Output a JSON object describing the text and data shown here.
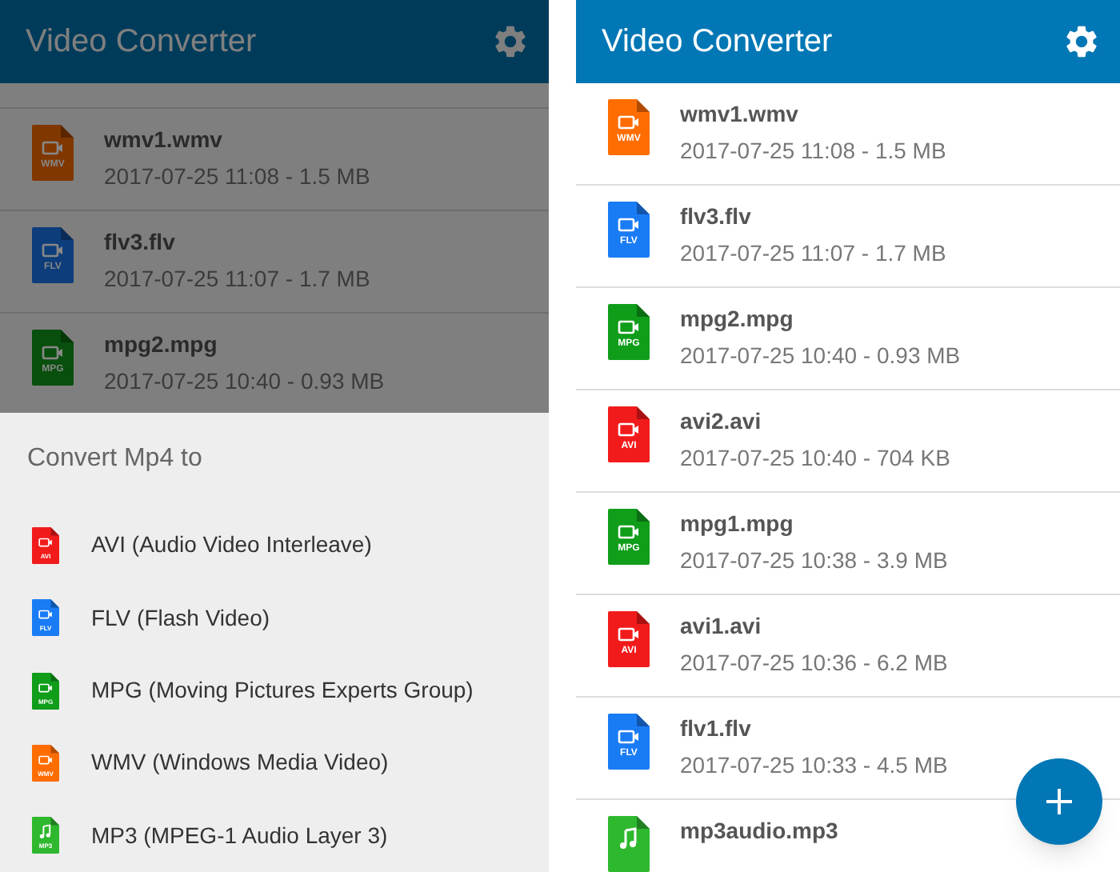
{
  "left_screen": {
    "app_bar": {
      "title": "Video Converter"
    },
    "dimmed": true,
    "files": [
      {
        "name": "wmv1.wmv",
        "meta": "2017-07-25 11:08 - 1.5 MB",
        "kind": "video",
        "format": "WMV",
        "color": "#803700"
      },
      {
        "name": "flv3.flv",
        "meta": "2017-07-25 11:07 - 1.7 MB",
        "kind": "video",
        "format": "FLV",
        "color": "#0d3e7b"
      },
      {
        "name": "mpg2.mpg",
        "meta": "2017-07-25 10:40 - 0.93 MB",
        "kind": "video",
        "format": "MPG",
        "color": "#084f0d"
      }
    ],
    "convert_sheet": {
      "title": "Convert Mp4 to",
      "options": [
        {
          "label": "AVI (Audio Video Interleave)",
          "kind": "video",
          "format": "AVI",
          "color": "#f21b1b"
        },
        {
          "label": "FLV (Flash Video)",
          "kind": "video",
          "format": "FLV",
          "color": "#1a7cf5"
        },
        {
          "label": "MPG (Moving Pictures Experts Group)",
          "kind": "video",
          "format": "MPG",
          "color": "#0f9d1a"
        },
        {
          "label": "WMV (Windows Media Video)",
          "kind": "video",
          "format": "WMV",
          "color": "#ff6d00"
        },
        {
          "label": "MP3 (MPEG-1 Audio Layer 3)",
          "kind": "audio",
          "format": "MP3",
          "color": "#2eb82e"
        }
      ]
    }
  },
  "right_screen": {
    "app_bar": {
      "title": "Video Converter"
    },
    "files": [
      {
        "name": "wmv1.wmv",
        "meta": "2017-07-25 11:08 - 1.5 MB",
        "kind": "video",
        "format": "WMV",
        "color": "#ff6d00"
      },
      {
        "name": "flv3.flv",
        "meta": "2017-07-25 11:07 - 1.7 MB",
        "kind": "video",
        "format": "FLV",
        "color": "#1a7cf5"
      },
      {
        "name": "mpg2.mpg",
        "meta": "2017-07-25 10:40 - 0.93 MB",
        "kind": "video",
        "format": "MPG",
        "color": "#0f9d1a"
      },
      {
        "name": "avi2.avi",
        "meta": "2017-07-25 10:40 - 704 KB",
        "kind": "video",
        "format": "AVI",
        "color": "#f21b1b"
      },
      {
        "name": "mpg1.mpg",
        "meta": "2017-07-25 10:38 - 3.9 MB",
        "kind": "video",
        "format": "MPG",
        "color": "#0f9d1a"
      },
      {
        "name": "avi1.avi",
        "meta": "2017-07-25 10:36 - 6.2 MB",
        "kind": "video",
        "format": "AVI",
        "color": "#f21b1b"
      },
      {
        "name": "flv1.flv",
        "meta": "2017-07-25 10:33 - 4.5 MB",
        "kind": "video",
        "format": "FLV",
        "color": "#1a7cf5"
      },
      {
        "name": "mp3audio.mp3",
        "kind": "audio",
        "color": "#2eb82e"
      }
    ]
  }
}
